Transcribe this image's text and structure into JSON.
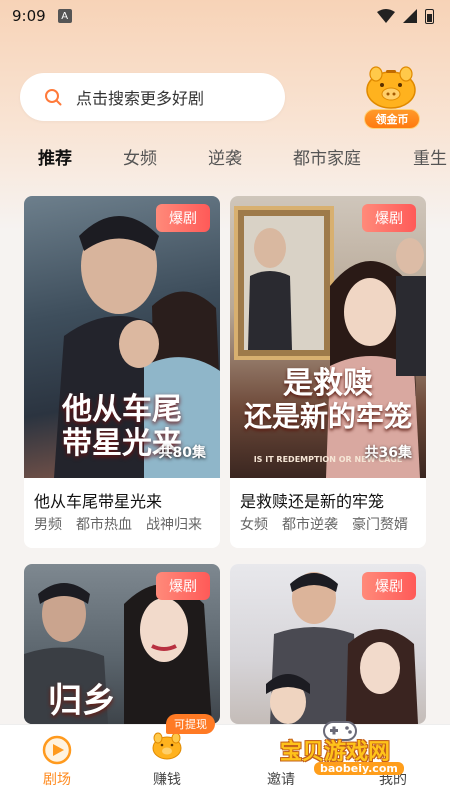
{
  "status_bar": {
    "time": "9:09",
    "notification_icon": "A"
  },
  "search": {
    "placeholder": "点击搜索更多好剧"
  },
  "coin": {
    "label": "领金币",
    "icon": "piggy-bank-icon"
  },
  "tabs": [
    {
      "label": "推荐",
      "active": true
    },
    {
      "label": "女频",
      "active": false
    },
    {
      "label": "逆袭",
      "active": false
    },
    {
      "label": "都市家庭",
      "active": false
    },
    {
      "label": "重生",
      "active": false
    }
  ],
  "dramas": [
    {
      "badge": "爆剧",
      "poster_text_line1": "他从车尾",
      "poster_text_line2": "带星光来",
      "episodes": "共80集",
      "title": "他从车尾带星光来",
      "tags": [
        "男频",
        "都市热血",
        "战神归来"
      ]
    },
    {
      "badge": "爆剧",
      "poster_text_line1": "是救赎",
      "poster_text_line2": "还是新的牢笼",
      "poster_subtitle": "IS IT REDEMPTION OR NEW CAGE",
      "episodes": "共36集",
      "title": "是救赎还是新的牢笼",
      "tags": [
        "女频",
        "都市逆袭",
        "豪门赘婿"
      ]
    },
    {
      "badge": "爆剧",
      "poster_text_line1": "归乡",
      "title": "",
      "tags": []
    },
    {
      "badge": "爆剧",
      "title": "",
      "tags": []
    }
  ],
  "bottom_nav": [
    {
      "label": "剧场",
      "icon": "play-icon",
      "active": true
    },
    {
      "label": "赚钱",
      "icon": "piggy-bank-icon",
      "active": false,
      "badge": "可提现"
    },
    {
      "label": "邀请",
      "icon": "invite-icon",
      "active": false
    },
    {
      "label": "我的",
      "icon": "profile-icon",
      "active": false
    }
  ],
  "watermark": {
    "text": "宝贝游戏网",
    "url": "baobeiy.com"
  },
  "colors": {
    "accent": "#ff8a1e",
    "badge": "#ff5a58"
  }
}
